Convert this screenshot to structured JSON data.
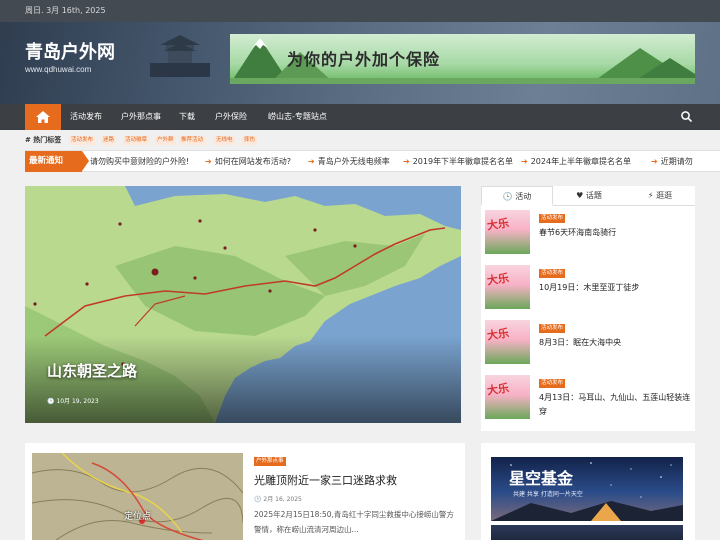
{
  "topbar": {
    "date": "周日. 3月 16th, 2025"
  },
  "header": {
    "site_title": "青岛户外网",
    "site_url": "www.qdhuwai.com",
    "banner_text": "为你的户外加个保险"
  },
  "nav": {
    "items": [
      "活动发布",
      "户外那点事",
      "下载",
      "户外保险",
      "崂山志-专题站点"
    ]
  },
  "tags": {
    "label": "# 热门标签",
    "items": [
      "活动发布",
      "迷路",
      "活动徽章",
      "户外群",
      "推荐活动",
      "无线电",
      "摔伤"
    ]
  },
  "notice": {
    "label": "最新通知",
    "items": [
      "请勿购买中意财险的户外险!",
      "如何在网站发布活动?",
      "青岛户外无线电频率",
      "2019年下半年徽章提名名单",
      "2024年上半年徽章提名名单",
      "近期请勿"
    ]
  },
  "hero": {
    "title": "山东朝圣之路",
    "date": "10月 19, 2023"
  },
  "sidebar": {
    "tabs": [
      "活动",
      "话题",
      "逛逛"
    ],
    "items": [
      {
        "category": "活动发布",
        "title": "春节6天环海南岛骑行"
      },
      {
        "category": "活动发布",
        "title": "10月19日：木里至亚丁徒步"
      },
      {
        "category": "活动发布",
        "title": "8月3日：眠在大海中央"
      },
      {
        "category": "活动发布",
        "title": "4月13日：马耳山、九仙山、五莲山轻装连穿"
      }
    ]
  },
  "card": {
    "category": "户外那点事",
    "title": "光雕顶附近一家三口迷路求救",
    "date": "2月 16, 2025",
    "excerpt": "2025年2月15日18:50,青岛红十字同尘救援中心接崂山警方警情，称在崂山流清河周边山...",
    "map_label": "定位点"
  },
  "ad": {
    "title": "星空基金",
    "subtitle": "共建 共享 打造同一片天空"
  }
}
